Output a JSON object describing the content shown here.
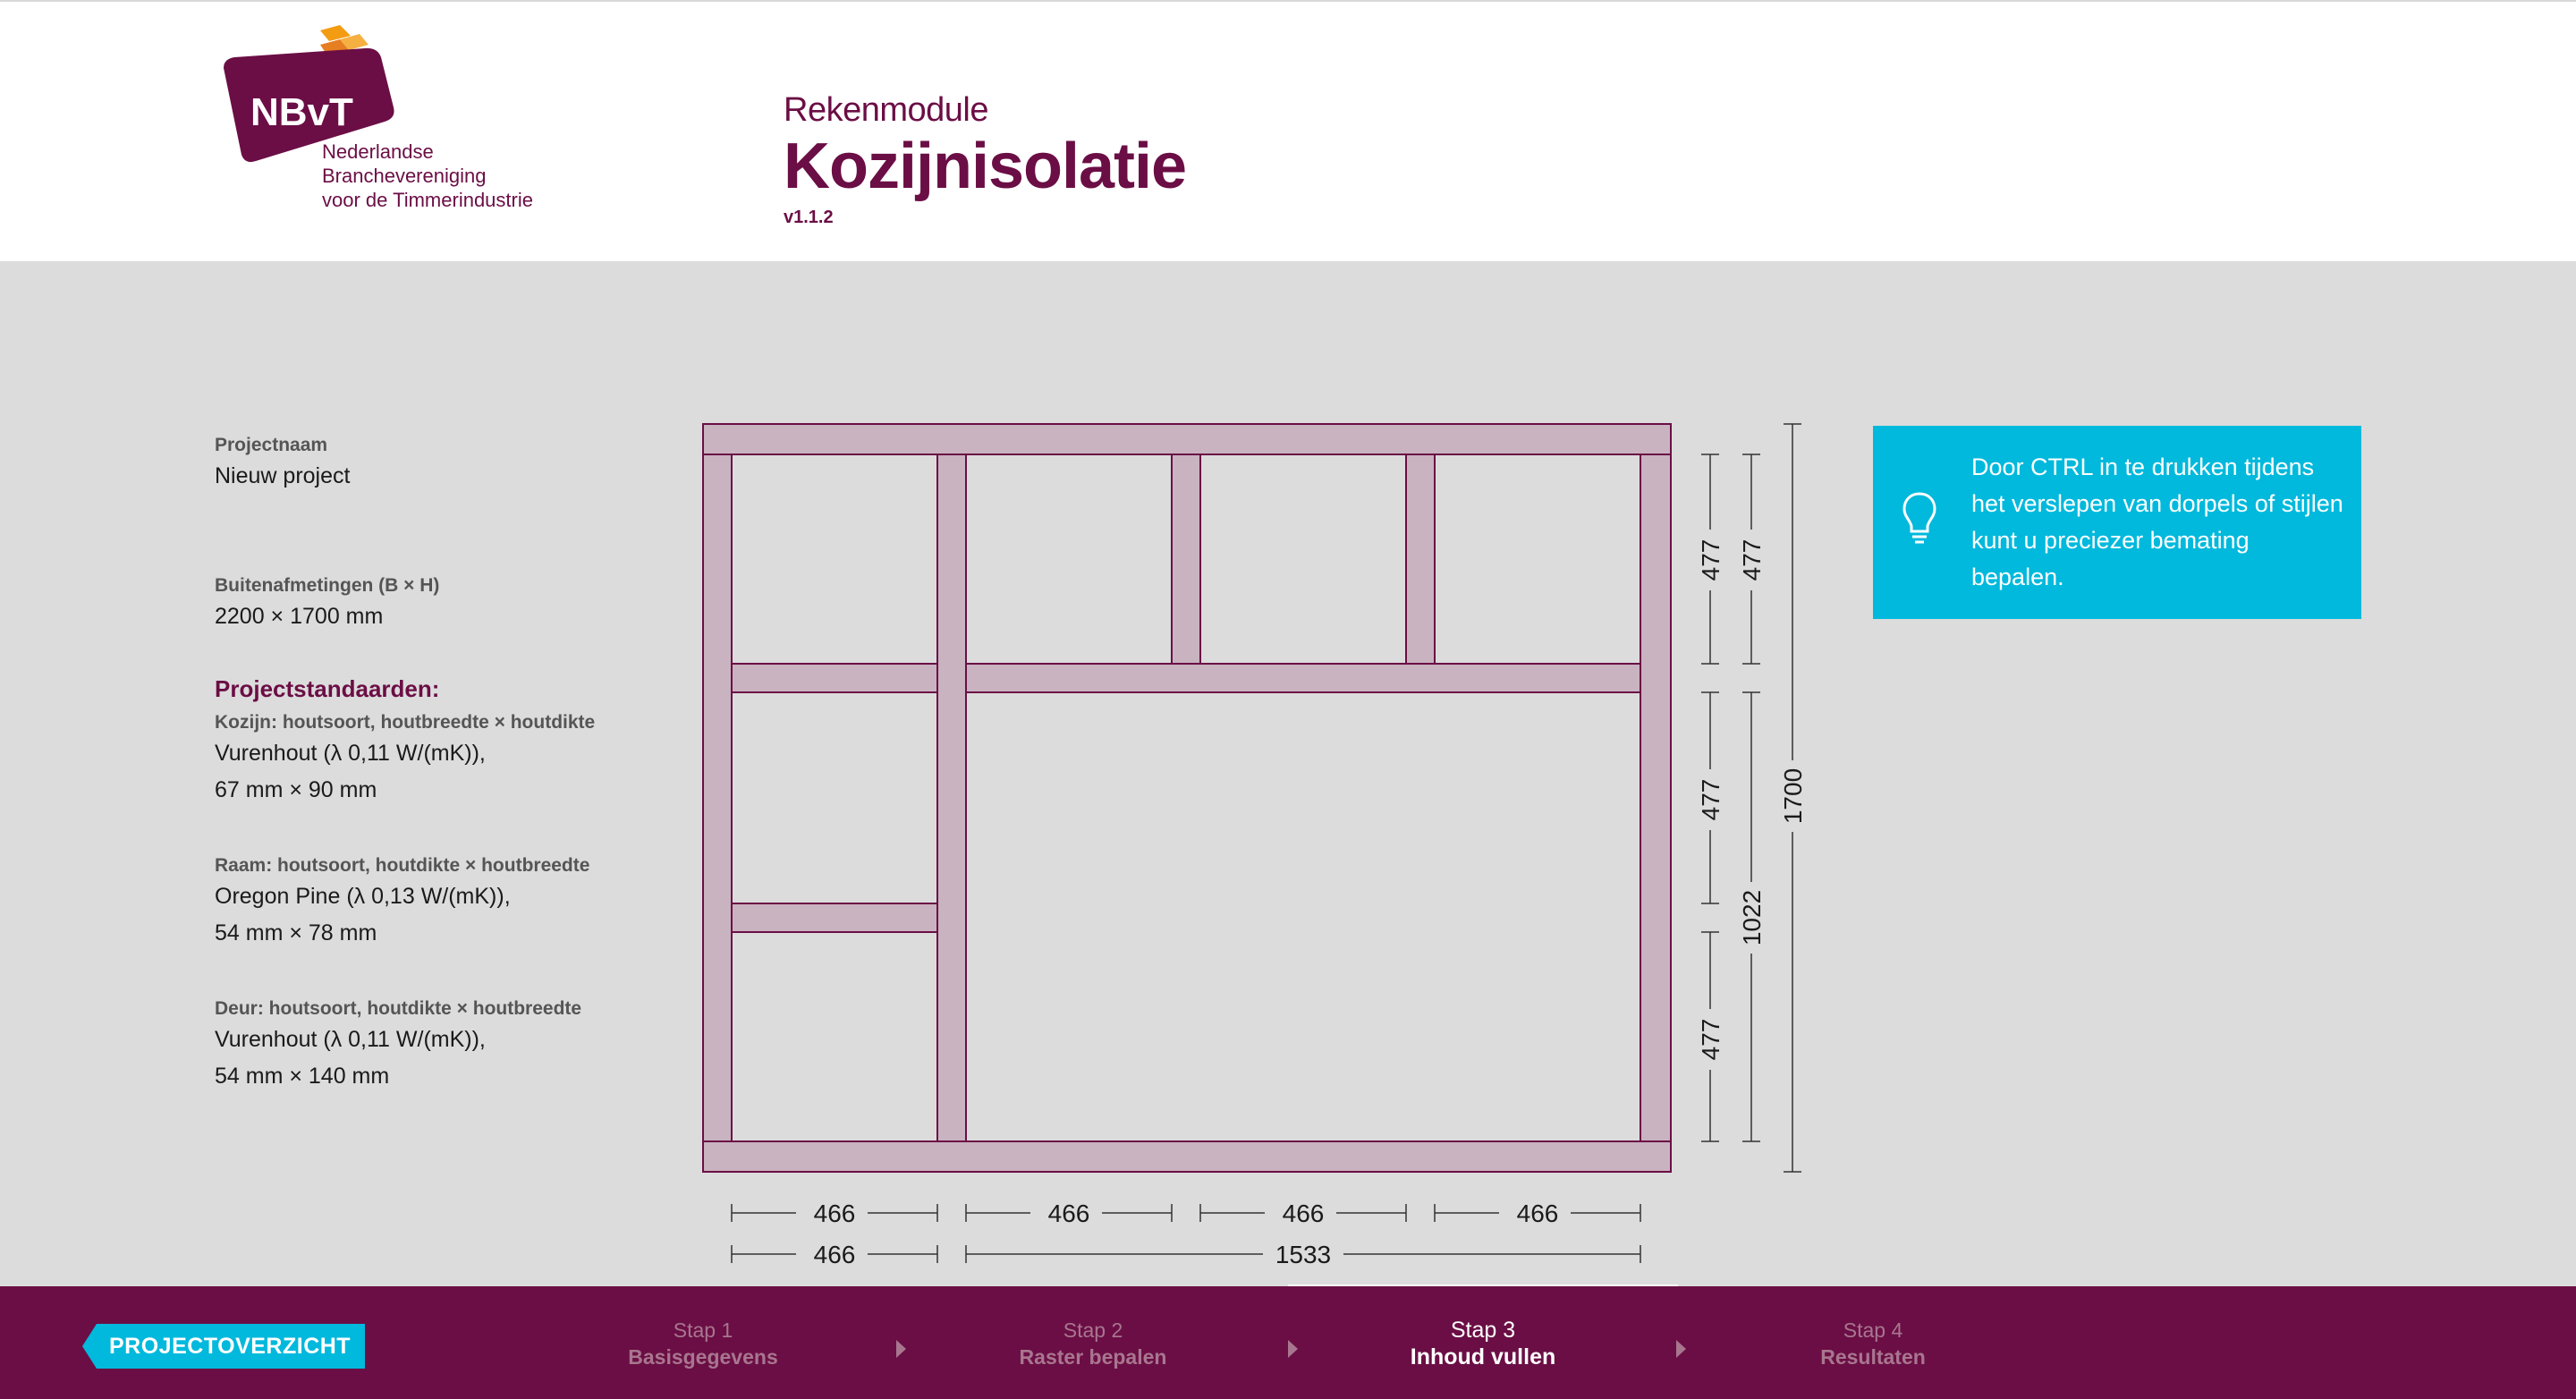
{
  "header": {
    "logo": {
      "mark": "NBvT",
      "lines": [
        "Nederlandse",
        "Branchevereniging",
        "voor de Timmerindustrie"
      ]
    },
    "subtitle": "Rekenmodule",
    "title": "Kozijnisolatie",
    "version": "v1.1.2"
  },
  "project": {
    "name_label": "Projectnaam",
    "name_value": "Nieuw project",
    "dims_label": "Buitenafmetingen (B × H)",
    "dims_value": "2200 × 1700 mm",
    "standards_title": "Projectstandaarden:",
    "kozijn_label": "Kozijn: houtsoort, houtbreedte × houtdikte",
    "kozijn_value1": "Vurenhout (λ 0,11 W/(mK)),",
    "kozijn_value2": "67 mm × 90 mm",
    "raam_label": "Raam: houtsoort, houtdikte × houtbreedte",
    "raam_value1": "Oregon Pine (λ 0,13 W/(mK)),",
    "raam_value2": "54 mm × 78 mm",
    "deur_label": "Deur: houtsoort, houtdikte × houtbreedte",
    "deur_value1": "Vurenhout (λ 0,11 W/(mK)),",
    "deur_value2": "54 mm × 140 mm"
  },
  "dimensions": {
    "bottom_row1": [
      "466",
      "466",
      "466",
      "466"
    ],
    "bottom_row2": [
      "466",
      "1533"
    ],
    "right_col1": [
      "477",
      "477",
      "477"
    ],
    "right_col2": [
      "477",
      "1022"
    ],
    "right_total": "1700"
  },
  "tip": {
    "icon": "lightbulb-icon",
    "text": "Door CTRL in te drukken tijdens het verslepen van dorpels of stijlen kunt u preciezer bemating bepalen."
  },
  "footer": {
    "back_label": "PROJECTOVERZICHT",
    "steps": [
      {
        "num": "Stap 1",
        "name": "Basisgegevens"
      },
      {
        "num": "Stap 2",
        "name": "Raster bepalen"
      },
      {
        "num": "Stap 3",
        "name": "Inhoud vullen"
      },
      {
        "num": "Stap 4",
        "name": "Resultaten"
      }
    ],
    "active_step": 3
  },
  "colors": {
    "brand": "#6b0e45",
    "accent": "#00b9dc",
    "frame_fill": "#c9b3c0",
    "frame_stroke": "#6b0e45"
  }
}
